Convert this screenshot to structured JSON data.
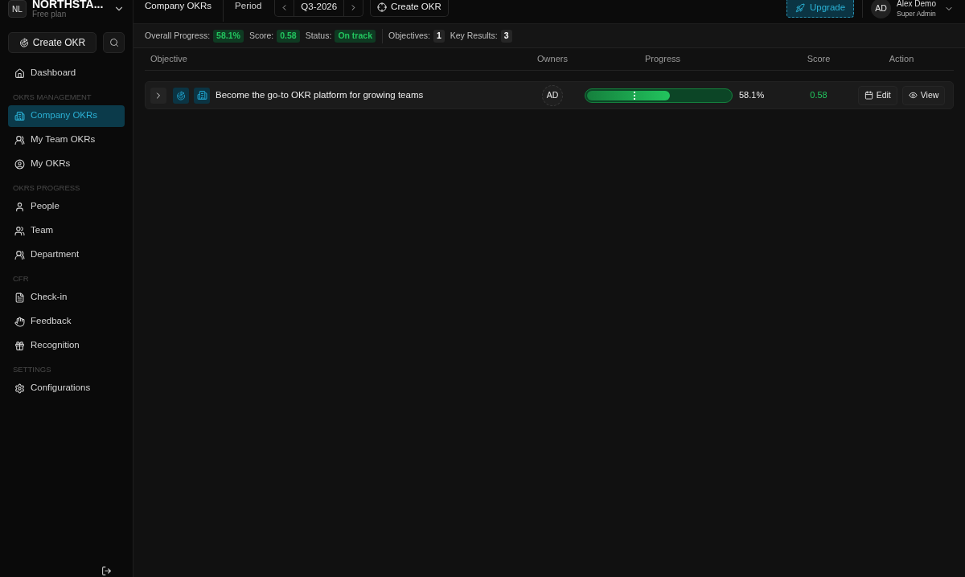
{
  "sidebar": {
    "org": {
      "initials": "NL",
      "name": "NORTHSTA...",
      "plan": "Free plan"
    },
    "create_button": "Create OKR",
    "groups": [
      {
        "items": [
          {
            "label": "Dashboard",
            "selected": false
          }
        ]
      },
      {
        "heading": "OKRS MANAGEMENT",
        "items": [
          {
            "label": "Company OKRs",
            "selected": true
          },
          {
            "label": "My Team OKRs",
            "selected": false
          },
          {
            "label": "My OKRs",
            "selected": false
          }
        ]
      },
      {
        "heading": "OKRS PROGRESS",
        "items": [
          {
            "label": "People",
            "selected": false
          },
          {
            "label": "Team",
            "selected": false
          },
          {
            "label": "Department",
            "selected": false
          }
        ]
      },
      {
        "heading": "CFR",
        "items": [
          {
            "label": "Check-in",
            "selected": false
          },
          {
            "label": "Feedback",
            "selected": false
          },
          {
            "label": "Recognition",
            "selected": false
          }
        ]
      },
      {
        "heading": "SETTINGS",
        "items": [
          {
            "label": "Configurations",
            "selected": false
          }
        ]
      }
    ]
  },
  "topbar": {
    "title": "Company OKRs",
    "period_label": "Period",
    "period": "Q3-2026",
    "create_button": "Create OKR",
    "upgrade_button": "Upgrade",
    "user": {
      "initials": "AD",
      "name": "Alex Demo",
      "role": "Super Admin"
    }
  },
  "stats": [
    {
      "label": "Overall Progress:",
      "value": "58.1%",
      "kind": "positive"
    },
    {
      "label": "Score:",
      "value": "0.58",
      "kind": "positive"
    },
    {
      "label": "Status:",
      "value": "On track",
      "kind": "positive"
    },
    {
      "label": "Objectives:",
      "value": "1",
      "kind": "count"
    },
    {
      "label": "Key Results:",
      "value": "3",
      "kind": "count"
    }
  ],
  "table": {
    "columns": [
      "Objective",
      "Owners",
      "Progress",
      "Score",
      "Action"
    ],
    "rows": [
      {
        "expanded": false,
        "title": "Become the go-to OKR platform for growing teams",
        "owner": "AD",
        "level": 0.581,
        "progress": "58.1%",
        "score": "0.58",
        "actions": [
          {
            "label": "Edit",
            "kind": "edit"
          },
          {
            "label": "View",
            "kind": "view"
          }
        ]
      }
    ]
  }
}
